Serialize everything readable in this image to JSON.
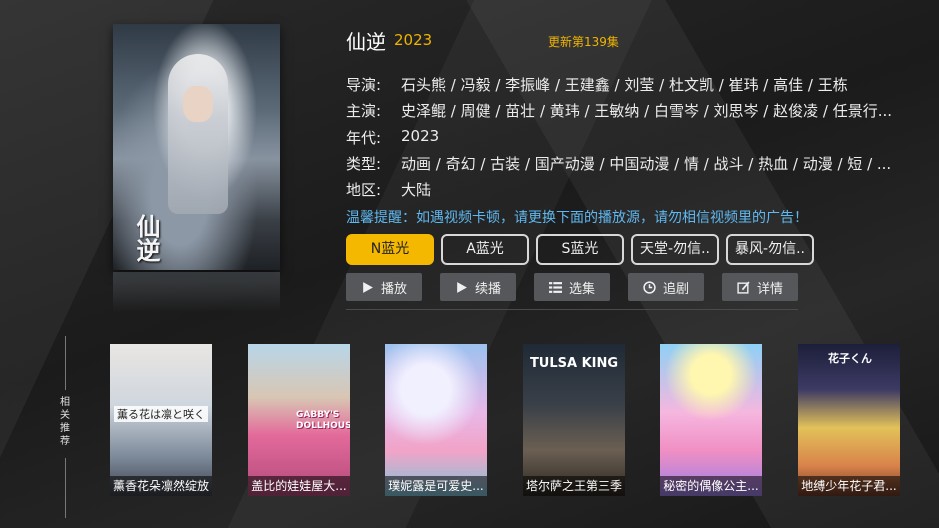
{
  "show": {
    "title": "仙逆",
    "year": "2023",
    "update": "更新第139集",
    "poster_logo": "仙逆"
  },
  "info": [
    {
      "label": "导演:",
      "value": "石头熊 / 冯毅 / 李振峰 / 王建鑫 / 刘莹 / 杜文凯 / 崔玮 / 高佳 / 王栋"
    },
    {
      "label": "主演:",
      "value": "史泽鲲 / 周健 / 苗壮 / 黄玮 / 王敏纳 / 白雪岑 / 刘思岑 / 赵俊凌 / 任景行..."
    },
    {
      "label": "年代:",
      "value": "2023"
    },
    {
      "label": "类型:",
      "value": "动画 / 奇幻 / 古装 / 国产动漫 / 中国动漫 / 情 / 战斗 / 热血 / 动漫 / 短 / ..."
    },
    {
      "label": "地区:",
      "value": "大陆"
    }
  ],
  "tip": "温馨提醒：如遇视频卡顿，请更换下面的播放源，请勿相信视频里的广告！",
  "sources": [
    "N蓝光",
    "A蓝光",
    "S蓝光",
    "天堂-勿信..",
    "暴风-勿信.."
  ],
  "actions": [
    {
      "label": "播放",
      "icon": "play-icon"
    },
    {
      "label": "续播",
      "icon": "play-icon"
    },
    {
      "label": "选集",
      "icon": "list-icon"
    },
    {
      "label": "追剧",
      "icon": "clock-icon"
    },
    {
      "label": "详情",
      "icon": "edit-icon"
    }
  ],
  "related": {
    "label": "相关推荐",
    "items": [
      {
        "caption": "薰香花朵凛然绽放",
        "poster_text": "薫る花は凛と咲く"
      },
      {
        "caption": "盖比的娃娃屋大...",
        "poster_text": "GABBY'S DOLLHOUSE"
      },
      {
        "caption": "璞妮露是可爱史...",
        "poster_text": ""
      },
      {
        "caption": "塔尔萨之王第三季",
        "poster_text": "TULSA KING"
      },
      {
        "caption": "秘密的偶像公主...",
        "poster_text": ""
      },
      {
        "caption": "地缚少年花子君...",
        "poster_text": "花子くん"
      }
    ]
  },
  "colors": {
    "accent": "#f5b800",
    "tip": "#5fb8f0",
    "year": "#f0b400"
  }
}
